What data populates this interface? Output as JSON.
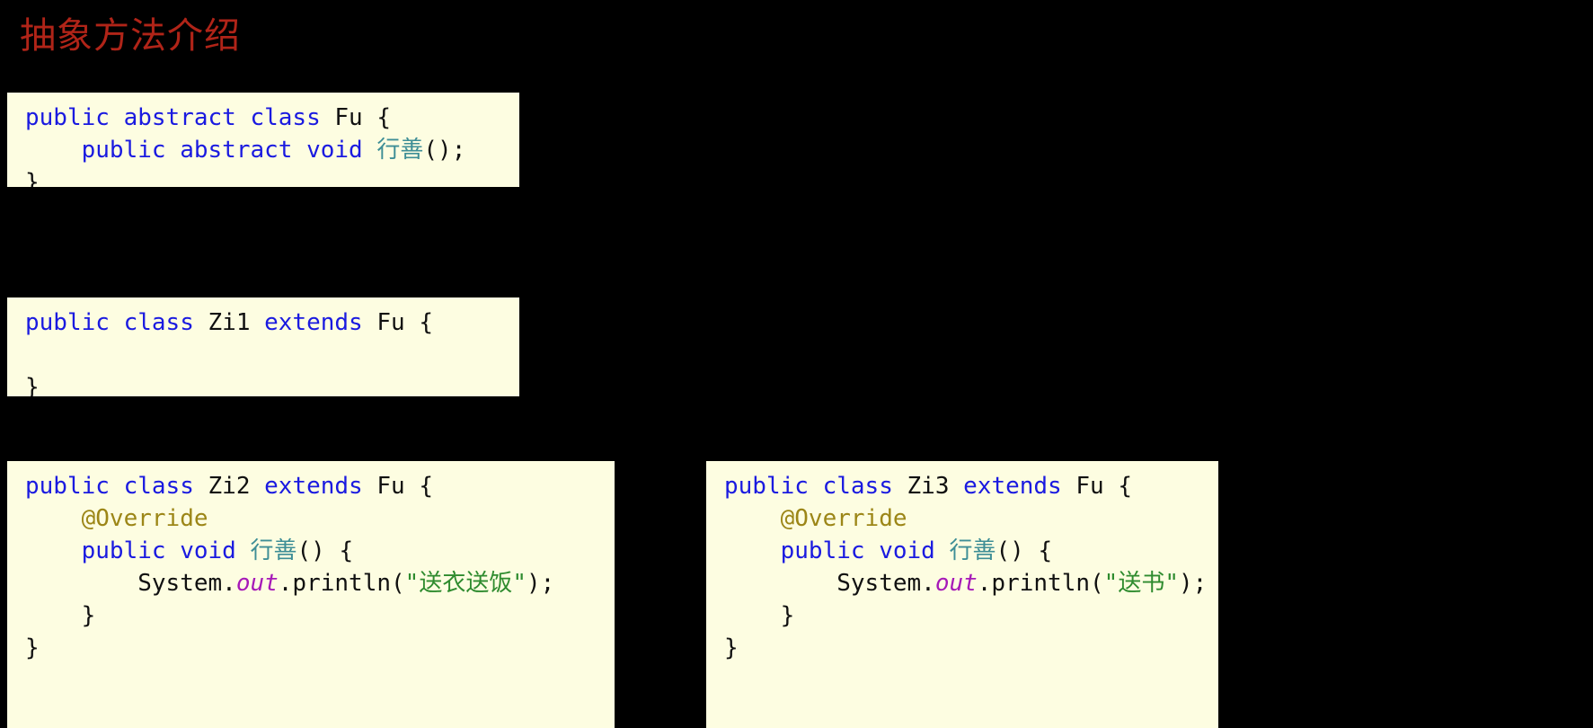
{
  "slide": {
    "title": "抽象方法介绍",
    "title_color": "#B02418",
    "background_color": "#000000",
    "code_background_color": "#FDFDE1"
  },
  "syntax_colors": {
    "keyword": "#1A1AE0",
    "identifier": "#101010",
    "method_name": "#3E8E96",
    "annotation": "#9C8617",
    "static_field": "#A619B8",
    "string": "#2E8B2E"
  },
  "code_blocks": {
    "fu": {
      "name": "Fu",
      "lines": [
        {
          "tokens": [
            {
              "t": "public",
              "k": "kw"
            },
            {
              "t": " ",
              "k": "punct"
            },
            {
              "t": "abstract",
              "k": "kw"
            },
            {
              "t": " ",
              "k": "punct"
            },
            {
              "t": "class",
              "k": "kw"
            },
            {
              "t": " ",
              "k": "punct"
            },
            {
              "t": "Fu",
              "k": "id"
            },
            {
              "t": " {",
              "k": "punct"
            }
          ]
        },
        {
          "tokens": [
            {
              "t": "    ",
              "k": "punct"
            },
            {
              "t": "public",
              "k": "kw"
            },
            {
              "t": " ",
              "k": "punct"
            },
            {
              "t": "abstract",
              "k": "kw"
            },
            {
              "t": " ",
              "k": "punct"
            },
            {
              "t": "void",
              "k": "kw"
            },
            {
              "t": " ",
              "k": "punct"
            },
            {
              "t": "行善",
              "k": "method"
            },
            {
              "t": "();",
              "k": "punct"
            }
          ]
        },
        {
          "tokens": [
            {
              "t": "}",
              "k": "punct"
            }
          ]
        }
      ]
    },
    "zi1": {
      "name": "Zi1",
      "lines": [
        {
          "tokens": [
            {
              "t": "public",
              "k": "kw"
            },
            {
              "t": " ",
              "k": "punct"
            },
            {
              "t": "class",
              "k": "kw"
            },
            {
              "t": " ",
              "k": "punct"
            },
            {
              "t": "Zi1",
              "k": "id"
            },
            {
              "t": " ",
              "k": "punct"
            },
            {
              "t": "extends",
              "k": "kw"
            },
            {
              "t": " ",
              "k": "punct"
            },
            {
              "t": "Fu",
              "k": "id"
            },
            {
              "t": " {",
              "k": "punct"
            }
          ]
        },
        {
          "tokens": [
            {
              "t": " ",
              "k": "punct"
            }
          ]
        },
        {
          "tokens": [
            {
              "t": "}",
              "k": "punct"
            }
          ]
        }
      ]
    },
    "zi2": {
      "name": "Zi2",
      "lines": [
        {
          "tokens": [
            {
              "t": "public",
              "k": "kw"
            },
            {
              "t": " ",
              "k": "punct"
            },
            {
              "t": "class",
              "k": "kw"
            },
            {
              "t": " ",
              "k": "punct"
            },
            {
              "t": "Zi2",
              "k": "id"
            },
            {
              "t": " ",
              "k": "punct"
            },
            {
              "t": "extends",
              "k": "kw"
            },
            {
              "t": " ",
              "k": "punct"
            },
            {
              "t": "Fu",
              "k": "id"
            },
            {
              "t": " {",
              "k": "punct"
            }
          ]
        },
        {
          "tokens": [
            {
              "t": "    ",
              "k": "punct"
            },
            {
              "t": "@Override",
              "k": "anno"
            }
          ]
        },
        {
          "tokens": [
            {
              "t": "    ",
              "k": "punct"
            },
            {
              "t": "public",
              "k": "kw"
            },
            {
              "t": " ",
              "k": "punct"
            },
            {
              "t": "void",
              "k": "kw"
            },
            {
              "t": " ",
              "k": "punct"
            },
            {
              "t": "行善",
              "k": "method"
            },
            {
              "t": "() {",
              "k": "punct"
            }
          ]
        },
        {
          "tokens": [
            {
              "t": "        ",
              "k": "punct"
            },
            {
              "t": "System",
              "k": "id"
            },
            {
              "t": ".",
              "k": "punct"
            },
            {
              "t": "out",
              "k": "field"
            },
            {
              "t": ".println(",
              "k": "punct"
            },
            {
              "t": "\"送衣送饭\"",
              "k": "string"
            },
            {
              "t": ");",
              "k": "punct"
            }
          ]
        },
        {
          "tokens": [
            {
              "t": "    }",
              "k": "punct"
            }
          ]
        },
        {
          "tokens": [
            {
              "t": "}",
              "k": "punct"
            }
          ]
        }
      ]
    },
    "zi3": {
      "name": "Zi3",
      "lines": [
        {
          "tokens": [
            {
              "t": "public",
              "k": "kw"
            },
            {
              "t": " ",
              "k": "punct"
            },
            {
              "t": "class",
              "k": "kw"
            },
            {
              "t": " ",
              "k": "punct"
            },
            {
              "t": "Zi3",
              "k": "id"
            },
            {
              "t": " ",
              "k": "punct"
            },
            {
              "t": "extends",
              "k": "kw"
            },
            {
              "t": " ",
              "k": "punct"
            },
            {
              "t": "Fu",
              "k": "id"
            },
            {
              "t": " {",
              "k": "punct"
            }
          ]
        },
        {
          "tokens": [
            {
              "t": "    ",
              "k": "punct"
            },
            {
              "t": "@Override",
              "k": "anno"
            }
          ]
        },
        {
          "tokens": [
            {
              "t": "    ",
              "k": "punct"
            },
            {
              "t": "public",
              "k": "kw"
            },
            {
              "t": " ",
              "k": "punct"
            },
            {
              "t": "void",
              "k": "kw"
            },
            {
              "t": " ",
              "k": "punct"
            },
            {
              "t": "行善",
              "k": "method"
            },
            {
              "t": "() {",
              "k": "punct"
            }
          ]
        },
        {
          "tokens": [
            {
              "t": "        ",
              "k": "punct"
            },
            {
              "t": "System",
              "k": "id"
            },
            {
              "t": ".",
              "k": "punct"
            },
            {
              "t": "out",
              "k": "field"
            },
            {
              "t": ".println(",
              "k": "punct"
            },
            {
              "t": "\"送书\"",
              "k": "string"
            },
            {
              "t": ");",
              "k": "punct"
            }
          ]
        },
        {
          "tokens": [
            {
              "t": "    }",
              "k": "punct"
            }
          ]
        },
        {
          "tokens": [
            {
              "t": "}",
              "k": "punct"
            }
          ]
        }
      ]
    }
  }
}
